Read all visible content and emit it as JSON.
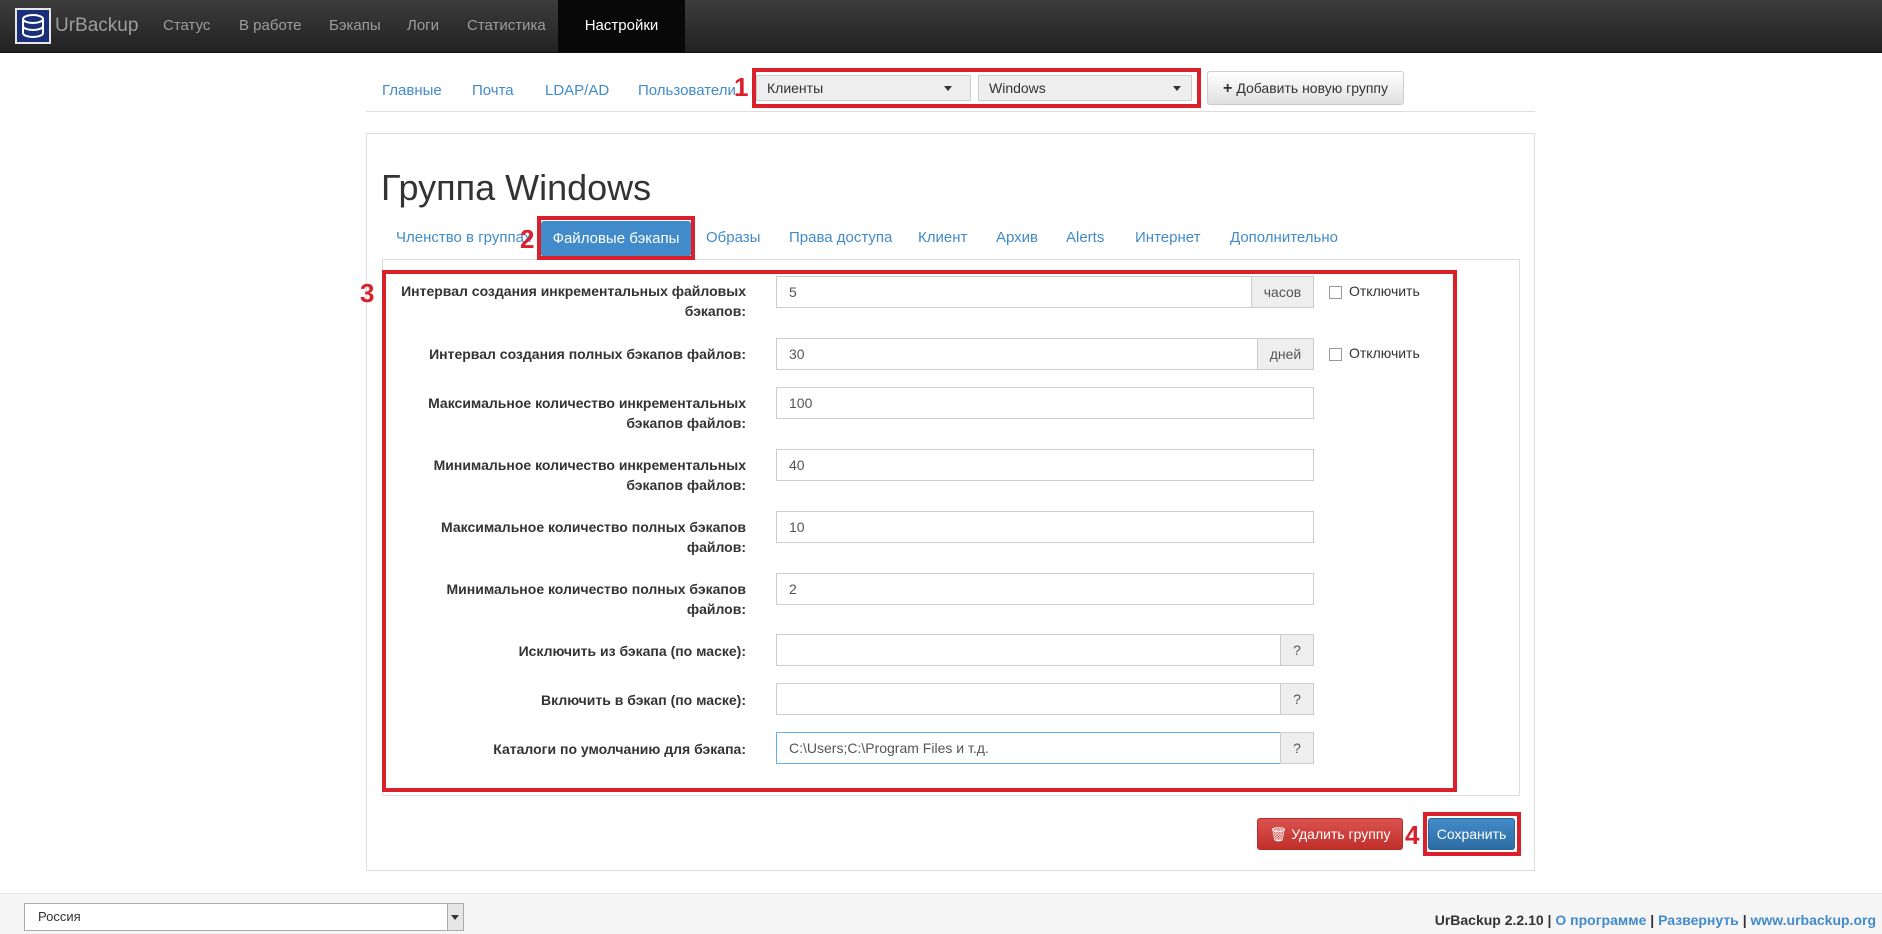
{
  "navbar": {
    "brand": "UrBackup",
    "items": [
      "Статус",
      "В работе",
      "Бэкапы",
      "Логи",
      "Статистика",
      "Настройки"
    ],
    "active": "Настройки"
  },
  "settings_tabs": [
    "Главные",
    "Почта",
    "LDAP/AD",
    "Пользователи"
  ],
  "selects": {
    "client_type": "Клиенты",
    "group": "Windows"
  },
  "add_group_label": "Добавить новую группу",
  "group_title": "Группа Windows",
  "group_tabs": [
    "Членство в группах",
    "Файловые бэкапы",
    "Образы",
    "Права доступа",
    "Клиент",
    "Архив",
    "Alerts",
    "Интернет",
    "Дополнительно"
  ],
  "active_group_tab": "Файловые бэкапы",
  "fields": {
    "incr_interval": {
      "label": "Интервал создания инкрементальных файловых бэкапов:",
      "value": "5",
      "unit": "часов",
      "disable_label": "Отключить"
    },
    "full_interval": {
      "label": "Интервал создания полных бэкапов файлов:",
      "value": "30",
      "unit": "дней",
      "disable_label": "Отключить"
    },
    "max_incr": {
      "label": "Максимальное количество инкрементальных бэкапов файлов:",
      "value": "100"
    },
    "min_incr": {
      "label": "Минимальное количество инкрементальных бэкапов файлов:",
      "value": "40"
    },
    "max_full": {
      "label": "Максимальное количество полных бэкапов файлов:",
      "value": "10"
    },
    "min_full": {
      "label": "Минимальное количество полных бэкапов файлов:",
      "value": "2"
    },
    "exclude": {
      "label": "Исключить из бэкапа (по маске):",
      "value": "",
      "help": "?"
    },
    "include": {
      "label": "Включить в бэкап (по маске):",
      "value": "",
      "help": "?"
    },
    "default_dirs": {
      "label": "Каталоги по умолчанию для бэкапа:",
      "value": "C:\\Users;C:\\Program Files и т.д.",
      "help": "?"
    }
  },
  "buttons": {
    "delete": "Удалить группу",
    "save": "Сохранить"
  },
  "annotations": [
    "1",
    "2",
    "3",
    "4"
  ],
  "footer": {
    "language": "Россия",
    "version": "UrBackup 2.2.10",
    "sep": "|",
    "about": "О программе",
    "expand": "Развернуть",
    "site": "www.urbackup.org"
  },
  "colors": {
    "accent": "#428bca",
    "danger": "#d9534f",
    "highlight": "#d9202b",
    "navbar": "#222222"
  }
}
